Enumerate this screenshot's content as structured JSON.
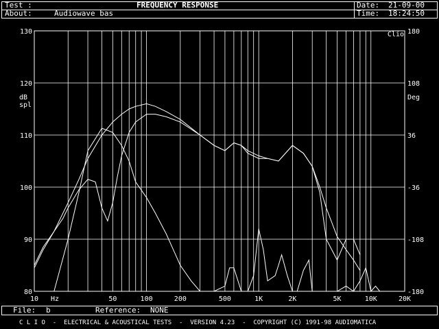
{
  "header": {
    "test_label": "Test :",
    "about_label": "About:",
    "about_value": "Audiowave bas",
    "title": "FREQUENCY RESPONSE",
    "date_label": "Date:",
    "date_value": "21-09-00",
    "time_label": "Time:",
    "time_value": "18:24:50"
  },
  "footer": {
    "file_label": "File:",
    "file_value": "b",
    "reference_label": "Reference:",
    "reference_value": "NONE",
    "banner": "C L I O  -  ELECTRICAL & ACOUSTICAL TESTS  -  VERSION 4.23  -  COPYRIGHT (C) 1991-98 AUDIOMATICA"
  },
  "chart_data": {
    "type": "line",
    "title": "FREQUENCY RESPONSE",
    "xlabel": "Hz",
    "ylabel_left": "dB spl",
    "ylabel_right": "Deg",
    "corner_label": "Clio",
    "x_scale": "log",
    "xlim": [
      10,
      20000
    ],
    "ylim": [
      80,
      130
    ],
    "ylim_right": [
      -180,
      180
    ],
    "x_ticks": [
      10,
      50,
      100,
      200,
      500,
      1000,
      2000,
      5000,
      10000,
      20000
    ],
    "x_tick_labels": [
      "10",
      "50",
      "100",
      "200",
      "500",
      "1K",
      "2K",
      "5K",
      "10K",
      "20K"
    ],
    "y_ticks": [
      80,
      90,
      100,
      110,
      120,
      130
    ],
    "y_ticks_right": [
      -180,
      -108,
      -36,
      36,
      108,
      180
    ],
    "grid": true,
    "color": "#ffffff",
    "series": [
      {
        "x": [
          10,
          12,
          15,
          20,
          25,
          30,
          40,
          50,
          60,
          70,
          80,
          100,
          120,
          150,
          200,
          300,
          400,
          500,
          600,
          700,
          800,
          1000,
          1200,
          1500,
          2000,
          2500,
          3000,
          3500,
          4000,
          5000,
          6000,
          7000,
          8000
        ],
        "y": [
          84.5,
          88,
          91.5,
          97,
          101.5,
          105.5,
          110,
          112.5,
          114,
          115,
          115.5,
          116,
          115.5,
          114.5,
          113,
          110,
          108,
          107,
          108.5,
          108,
          107,
          106,
          105.5,
          105,
          108,
          106.5,
          104,
          100,
          96,
          90.5,
          88,
          86,
          84
        ]
      },
      {
        "x": [
          10,
          12,
          15,
          18,
          20,
          25,
          30,
          35,
          40,
          45,
          50,
          55,
          60,
          70,
          80,
          100,
          120,
          150,
          200,
          300,
          400,
          500,
          600,
          700,
          800,
          1000,
          1200,
          1500,
          2000,
          2500,
          3000,
          3500,
          4000,
          5000,
          6000,
          7000,
          8000
        ],
        "y": [
          85,
          88.5,
          91.5,
          94,
          96,
          99.5,
          101.5,
          101,
          96,
          93.5,
          97,
          102,
          106,
          110.5,
          112.5,
          114,
          114,
          113.5,
          112.5,
          110,
          108,
          107,
          108.5,
          108,
          106.5,
          105.5,
          105.5,
          105,
          108,
          106.5,
          104,
          99,
          90,
          86,
          90,
          90,
          87
        ]
      },
      {
        "x": [
          15,
          20,
          25,
          30,
          40,
          50,
          60,
          70,
          80,
          100,
          120,
          150,
          200,
          250,
          300,
          350,
          400,
          500,
          550,
          600,
          700,
          800,
          900,
          1000,
          1100,
          1200,
          1400,
          1500,
          1600,
          1800,
          2000,
          2200,
          2500,
          2800,
          3000,
          4000,
          5000,
          6000,
          7000,
          8000,
          9000,
          10000,
          11000,
          12000
        ],
        "y": [
          78,
          90,
          99,
          107,
          111.3,
          110.5,
          108,
          105,
          101,
          98,
          95,
          91,
          85,
          82,
          80,
          78,
          76,
          81,
          84.5,
          84.5,
          79.5,
          80,
          83,
          92,
          88,
          82,
          83,
          85,
          87,
          83,
          80,
          79,
          84,
          86,
          80,
          78,
          79,
          81,
          80,
          82,
          84.5,
          80,
          81,
          79
        ]
      }
    ]
  }
}
